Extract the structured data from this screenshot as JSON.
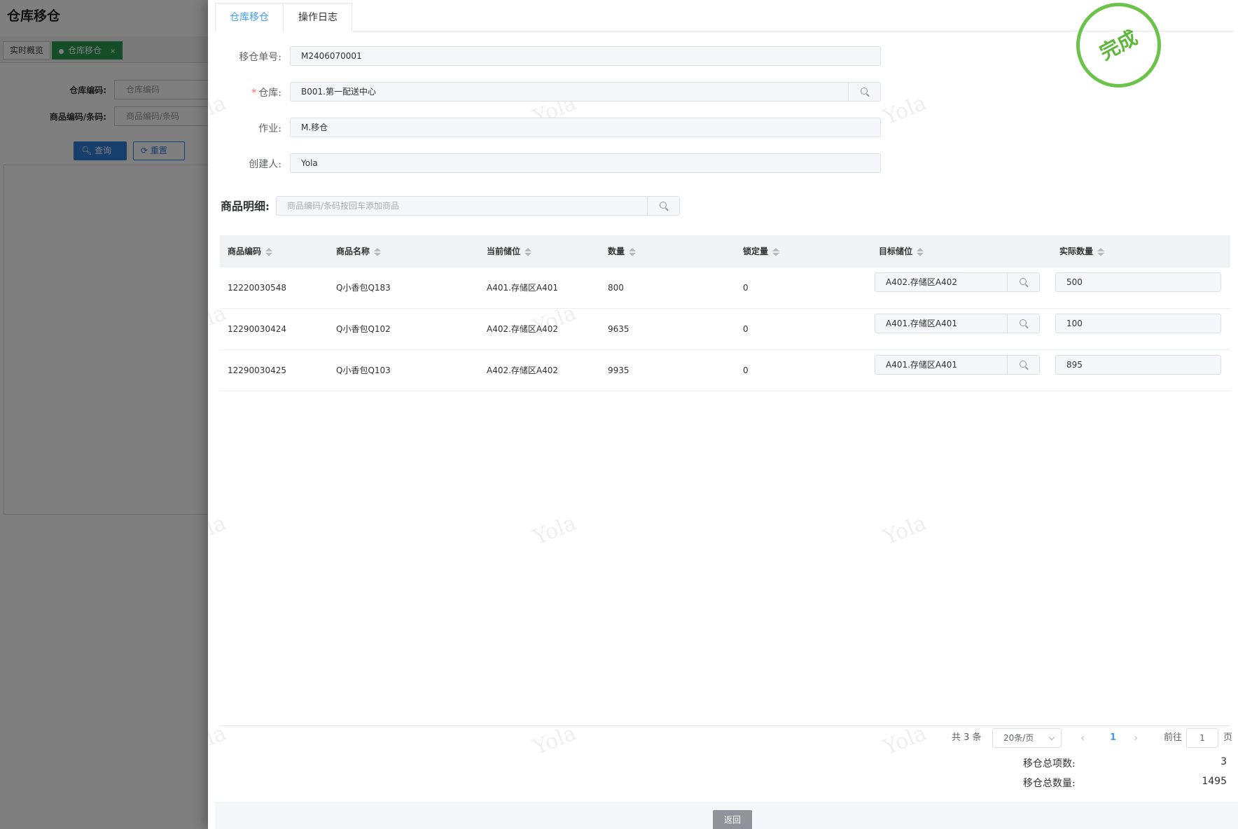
{
  "background": {
    "page_title": "仓库移仓",
    "tabs": [
      {
        "label": "实时概览"
      },
      {
        "label": "仓库移仓",
        "close": "×"
      }
    ],
    "form": {
      "warehouse_code_label": "仓库编码:",
      "warehouse_code_placeholder": "仓库编码",
      "product_code_label": "商品编码/条码:",
      "product_code_placeholder": "商品编码/条码"
    },
    "buttons": {
      "query": "查询",
      "reset": "重置"
    }
  },
  "drawer": {
    "tabs": [
      {
        "label": "仓库移仓",
        "active": true
      },
      {
        "label": "操作日志",
        "active": false
      }
    ],
    "stamp": "完成",
    "form": {
      "order_no_label": "移仓单号:",
      "order_no_value": "M2406070001",
      "warehouse_label": "仓库:",
      "warehouse_required": "*",
      "warehouse_value": "B001.第一配送中心",
      "task_label": "作业:",
      "task_value": "M.移仓",
      "creator_label": "创建人:",
      "creator_value": "Yola"
    },
    "detail": {
      "label": "商品明细:",
      "search_placeholder": "商品编码/条码按回车添加商品"
    },
    "table": {
      "columns": [
        "商品编码",
        "商品名称",
        "当前储位",
        "数量",
        "锁定量",
        "目标储位",
        "实际数量"
      ],
      "rows": [
        {
          "code": "12220030548",
          "name": "Q小香包Q183",
          "current_location": "A401.存储区A401",
          "qty": "800",
          "locked": "0",
          "target_location": "A402.存储区A402",
          "actual_qty": "500"
        },
        {
          "code": "12290030424",
          "name": "Q小香包Q102",
          "current_location": "A402.存储区A402",
          "qty": "9635",
          "locked": "0",
          "target_location": "A401.存储区A401",
          "actual_qty": "100"
        },
        {
          "code": "12290030425",
          "name": "Q小香包Q103",
          "current_location": "A402.存储区A402",
          "qty": "9935",
          "locked": "0",
          "target_location": "A401.存储区A401",
          "actual_qty": "895"
        }
      ]
    },
    "pagination": {
      "total": "共 3 条",
      "page_size": "20条/页",
      "current_page": "1",
      "goto_label": "前往",
      "goto_value": "1",
      "page_suffix": "页"
    },
    "summary": {
      "total_items_label": "移仓总项数:",
      "total_items_value": "3",
      "total_qty_label": "移仓总数量:",
      "total_qty_value": "1495"
    },
    "back_button": "返回"
  },
  "watermark": "Yola",
  "colors": {
    "primary": "#409eff",
    "stamp_green": "#5cb83b",
    "bg_tab_active": "#2c9b52",
    "bg_query_button": "#2f7fd8",
    "back_button": "#909399"
  }
}
